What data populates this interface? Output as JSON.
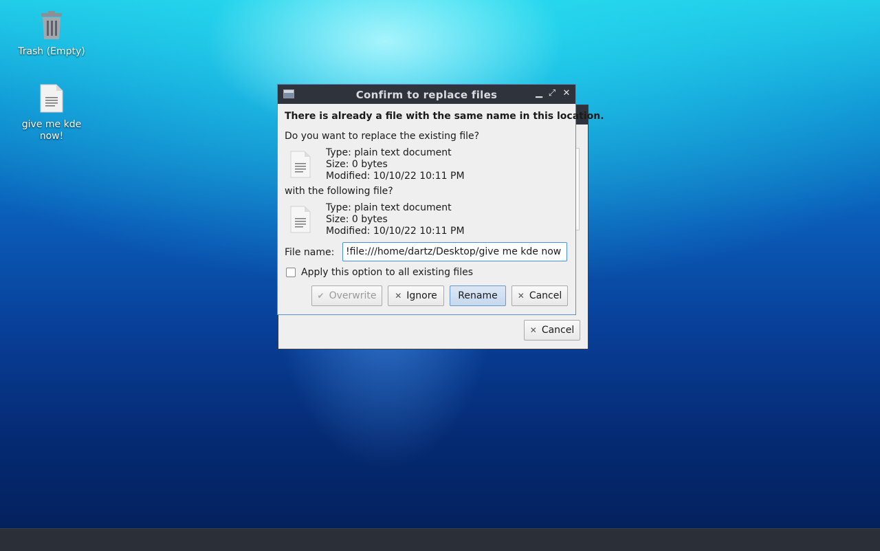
{
  "desktop": {
    "icons": [
      {
        "label": "Trash (Empty)",
        "icon": "trash-icon"
      },
      {
        "label": "give me kde now!",
        "icon": "text-file-icon"
      }
    ]
  },
  "dialog": {
    "title": "Confirm to replace files",
    "headline": "There is already a file with the same name in this location.",
    "question_existing": "Do you want to replace the existing file?",
    "existing_file": {
      "type": "Type: plain text document",
      "size": "Size: 0 bytes",
      "modified": "Modified: 10/10/22 10:11 PM"
    },
    "question_new": "with the following file?",
    "new_file": {
      "type": "Type: plain text document",
      "size": "Size: 0 bytes",
      "modified": "Modified: 10/10/22 10:11 PM"
    },
    "file_name_label": "File name:",
    "file_name_value": "file:///home/dartz/Desktop/give me kde now!",
    "apply_all_label": "Apply this option to all existing files",
    "apply_all_checked": false,
    "buttons": {
      "overwrite": "Overwrite",
      "ignore": "Ignore",
      "rename": "Rename",
      "cancel": "Cancel"
    }
  },
  "parent_dialog": {
    "cancel_label": "Cancel"
  }
}
